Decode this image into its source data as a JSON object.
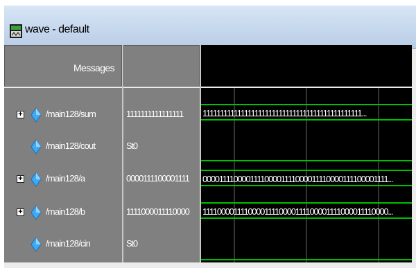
{
  "window": {
    "title": "wave - default"
  },
  "columns": {
    "messages": "Messages"
  },
  "signals": [
    {
      "name": "/main128/sum",
      "value": "1111111111111111",
      "kind": "bus",
      "expandable": true,
      "wave": "1111111111111111111111111111111111111111111111..."
    },
    {
      "name": "/main128/cout",
      "value": "St0",
      "kind": "bit",
      "expandable": false,
      "wave": ""
    },
    {
      "name": "/main128/a",
      "value": "0000111100001111",
      "kind": "bus",
      "expandable": true,
      "wave": "000011110000111100001111000011110000111100001111..."
    },
    {
      "name": "/main128/b",
      "value": "1111000011110000",
      "kind": "bus",
      "expandable": true,
      "wave": "111100001111000011110000111100001111000011110000..."
    },
    {
      "name": "/main128/cin",
      "value": "St0",
      "kind": "bit",
      "expandable": false,
      "wave": ""
    }
  ],
  "colors": {
    "wave_green": "#00c000",
    "cursor_gray": "#6a6a6a",
    "panel_gray": "#808080"
  }
}
